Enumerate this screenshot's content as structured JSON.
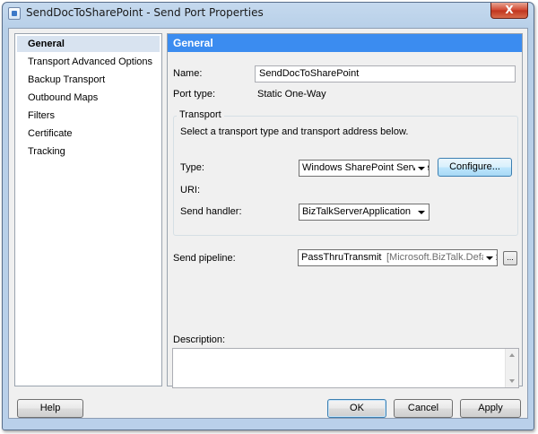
{
  "window": {
    "title": "SendDocToSharePoint - Send Port Properties",
    "close_glyph": "X"
  },
  "nav": {
    "items": [
      {
        "label": "General",
        "selected": true
      },
      {
        "label": "Transport Advanced Options"
      },
      {
        "label": "Backup Transport"
      },
      {
        "label": "Outbound Maps"
      },
      {
        "label": "Filters"
      },
      {
        "label": "Certificate"
      },
      {
        "label": "Tracking"
      }
    ]
  },
  "panel": {
    "header": "General",
    "name_label": "Name:",
    "name_value": "SendDocToSharePoint",
    "port_type_label": "Port type:",
    "port_type_value": "Static One-Way",
    "transport": {
      "title": "Transport",
      "instruction": "Select a transport type and transport address below.",
      "type_label": "Type:",
      "type_value": "Windows SharePoint Service",
      "configure_label": "Configure...",
      "uri_label": "URI:",
      "send_handler_label": "Send handler:",
      "send_handler_value": "BizTalkServerApplication"
    },
    "send_pipeline_label": "Send pipeline:",
    "send_pipeline_value": "PassThruTransmit",
    "send_pipeline_assembly": "[Microsoft.BizTalk.Default",
    "ellipsis_label": "...",
    "description_label": "Description:"
  },
  "footer": {
    "help_label": "Help",
    "ok_label": "OK",
    "cancel_label": "Cancel",
    "apply_label": "Apply"
  }
}
